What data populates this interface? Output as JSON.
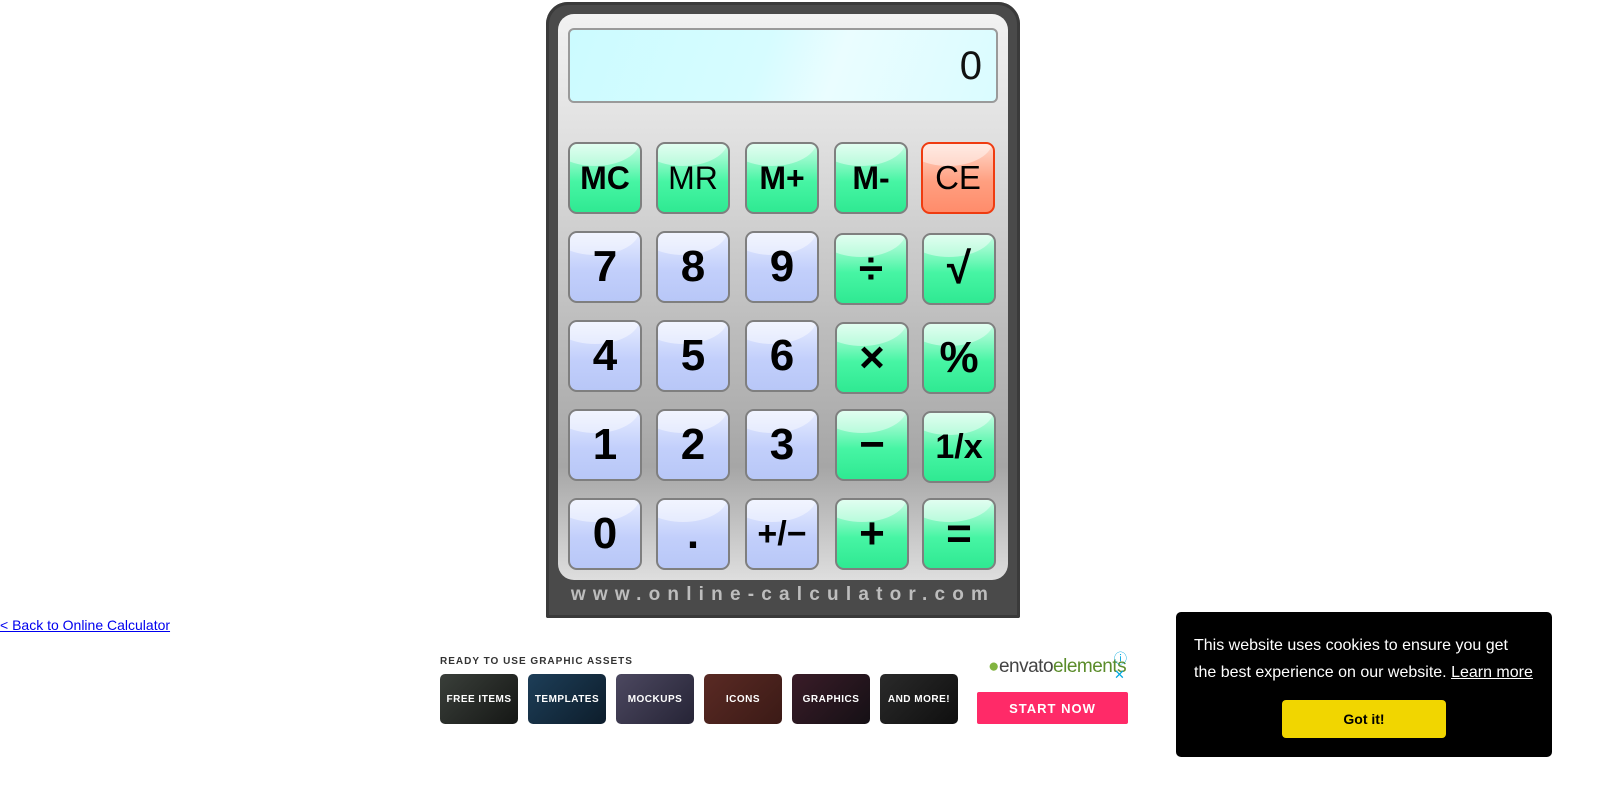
{
  "calculator": {
    "display": "0",
    "buttons": {
      "mc": "MC",
      "mr": "MR",
      "mplus": "M+",
      "mminus": "M-",
      "ce": "CE",
      "seven": "7",
      "eight": "8",
      "nine": "9",
      "divide": "÷",
      "sqrt": "√",
      "four": "4",
      "five": "5",
      "six": "6",
      "multiply": "×",
      "percent": "%",
      "one": "1",
      "two": "2",
      "three": "3",
      "minus": "−",
      "reciprocal": "1/x",
      "zero": "0",
      "decimal": ".",
      "plusminus": "+/−",
      "plus": "+",
      "equals": "="
    },
    "brand": "www.online-calculator.com"
  },
  "back_link": "< Back to Online Calculator",
  "ad": {
    "heading": "READY TO USE GRAPHIC ASSETS",
    "tiles": [
      "FREE ITEMS",
      "TEMPLATES",
      "MOCKUPS",
      "ICONS",
      "GRAPHICS",
      "AND MORE!"
    ],
    "logo": "envato",
    "logo_suffix": "elements",
    "cta": "START NOW",
    "colors": {
      "cta": "#ff2a68",
      "logo": "#82b440"
    }
  },
  "cookie_banner": {
    "message": "This website uses cookies to ensure you get the best experience on our website.",
    "learn_more": "Learn more",
    "accept": "Got it!",
    "colors": {
      "background": "#000000",
      "button": "#f1d600"
    }
  }
}
